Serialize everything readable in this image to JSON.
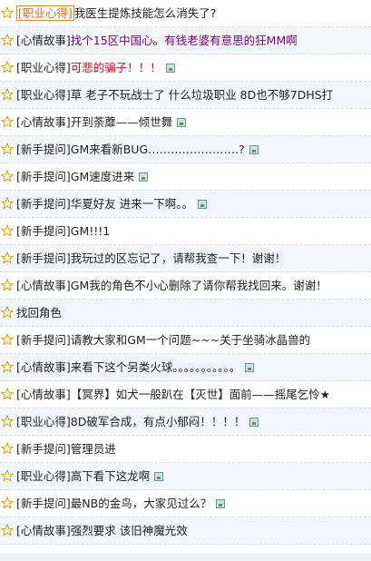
{
  "items": [
    {
      "category": "[职业心得]",
      "title": "我医生提炼技能怎么消失了?",
      "style": "",
      "pic": false,
      "boxed": true
    },
    {
      "category": "[心情故事]",
      "title": "找个15区中国心。有钱老婆有意思的狂MM啊",
      "style": "purple",
      "pic": false
    },
    {
      "category": "[职业心得]",
      "title": "可悲的骗子！！！",
      "style": "red",
      "pic": true
    },
    {
      "category": "[职业心得]",
      "title": "草 老子不玩战士了 什么垃圾职业 8D也不够7DHS打",
      "style": "",
      "pic": false
    },
    {
      "category": "[心情故事]",
      "title": "开到荼蘼——倾世舞",
      "style": "",
      "pic": true
    },
    {
      "category": "[新手提问]",
      "title": "GM来看新BUG……………………?",
      "style": "",
      "pic": true
    },
    {
      "category": "[新手提问]",
      "title": "GM速度进来",
      "style": "",
      "pic": true
    },
    {
      "category": "[新手提问]",
      "title": "华夏好友 进来一下啊。。",
      "style": "",
      "pic": true
    },
    {
      "category": "[新手提问]",
      "title": "GM!!!1",
      "style": "",
      "pic": false
    },
    {
      "category": "[新手提问]",
      "title": "我玩过的区忘记了，请帮我查一下！谢谢！",
      "style": "",
      "pic": false
    },
    {
      "category": "[心情故事]",
      "title": "GM我的角色不小心删除了请你帮我找回来。谢谢！",
      "style": "",
      "pic": false
    },
    {
      "category": "",
      "title": "找回角色",
      "style": "",
      "pic": false
    },
    {
      "category": "[新手提问]",
      "title": "请教大家和GM一个问题~~~关于坐骑冰晶兽的",
      "style": "",
      "pic": false
    },
    {
      "category": "[心情故事]",
      "title": "来看下这个另类火球。。。。。。。。。。。",
      "style": "",
      "pic": true
    },
    {
      "category": "[心情故事]",
      "title": "【冥界】如犬一般趴在【灭世】面前——摇尾乞怜★",
      "style": "",
      "pic": false
    },
    {
      "category": "[职业心得]",
      "title": "8D破军合成，有点小郁闷！！！！",
      "style": "",
      "pic": true
    },
    {
      "category": "[新手提问]",
      "title": "管理员进",
      "style": "",
      "pic": false
    },
    {
      "category": "[职业心得]",
      "title": "高下看下这龙啊",
      "style": "",
      "pic": true
    },
    {
      "category": "[新手提问]",
      "title": "最NB的金鸟，大家见过么？",
      "style": "",
      "pic": true
    },
    {
      "category": "[心情故事]",
      "title": "强烈要求 该旧神魔光效",
      "style": "",
      "pic": false
    }
  ],
  "icons": {
    "bullet": "star-outline-icon",
    "attachment": "image-attachment-icon"
  },
  "colors": {
    "star": "#c9a227",
    "purple": "#800080",
    "red": "#e0001b",
    "boxed": "#e08a3a"
  }
}
